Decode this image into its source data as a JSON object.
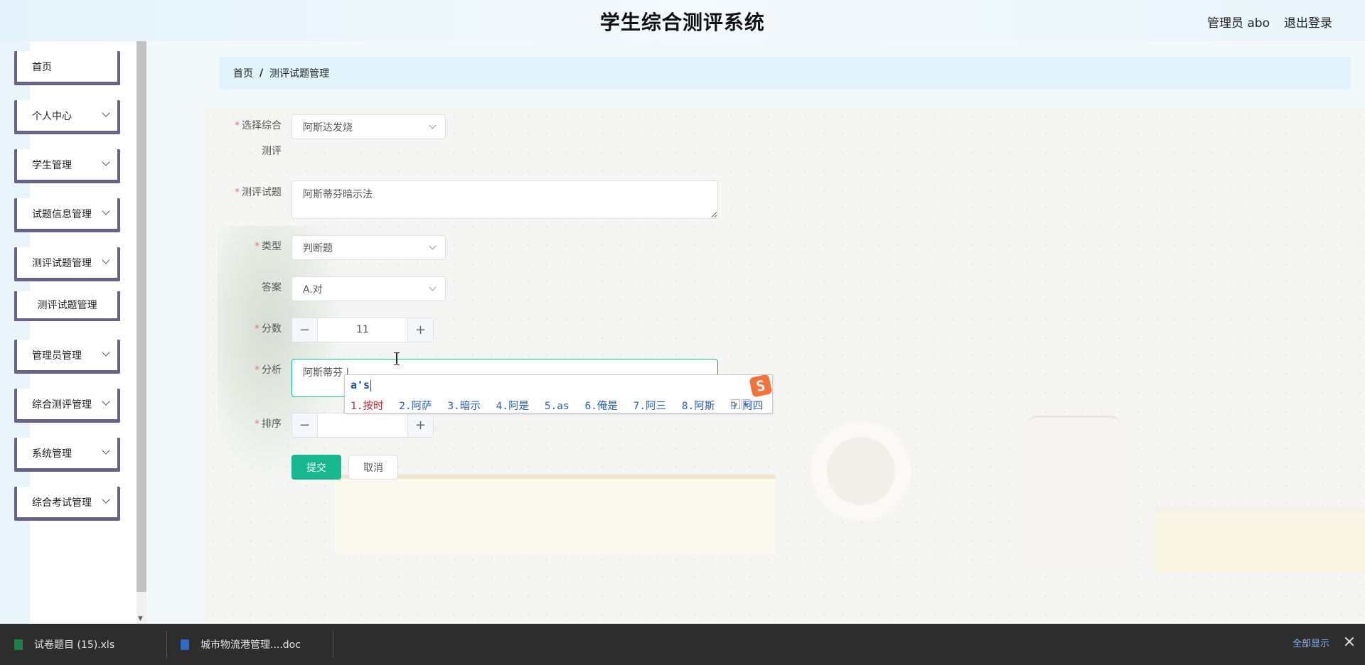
{
  "header": {
    "title": "学生综合测评系统",
    "user": "管理员 abo",
    "logout": "退出登录"
  },
  "sidebar": {
    "items": [
      {
        "label": "首页"
      },
      {
        "label": "个人中心"
      },
      {
        "label": "学生管理"
      },
      {
        "label": "试题信息管理"
      },
      {
        "label": "测评试题管理"
      },
      {
        "label": "测评试题管理"
      },
      {
        "label": "管理员管理"
      },
      {
        "label": "综合测评管理"
      },
      {
        "label": "系统管理"
      },
      {
        "label": "综合考试管理"
      }
    ]
  },
  "breadcrumb": {
    "home": "首页",
    "separator": "/",
    "current": "测评试题管理"
  },
  "form": {
    "evaluation": {
      "label_line1": "选择综合",
      "label_line2": "测评",
      "value": "阿斯达发烧"
    },
    "question": {
      "label": "测评试题",
      "value": "阿斯蒂芬暗示法"
    },
    "type": {
      "label": "类型",
      "value": "判断题"
    },
    "answer": {
      "label": "答案",
      "value": "A.对"
    },
    "score": {
      "label": "分数",
      "value": "11"
    },
    "analysis": {
      "label": "分析",
      "value": "阿斯蒂芬 |"
    },
    "order": {
      "label": "排序",
      "value": ""
    },
    "submit": "提交",
    "cancel": "取消",
    "minus": "−",
    "plus": "+"
  },
  "ime": {
    "composition": "a's",
    "candidates": [
      "1.按时",
      "2.阿萨",
      "3.暗示",
      "4.阿是",
      "5.as",
      "6.俺是",
      "7.阿三",
      "8.阿斯",
      "9.阿四"
    ],
    "logo": "S"
  },
  "downloads": {
    "items": [
      {
        "name": "试卷题目 (15).xls"
      },
      {
        "name": "城市物流港管理....doc"
      }
    ],
    "show_all": "全部显示"
  },
  "colors": {
    "primary": "#17b890",
    "sidebar_border": "#6a6186",
    "breadcrumb_bg": "#e1f4fb",
    "required": "#f56c6c"
  }
}
